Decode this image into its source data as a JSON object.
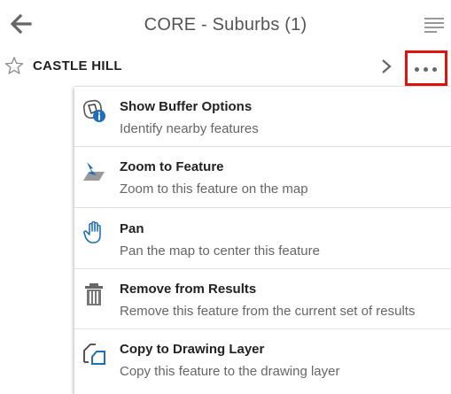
{
  "header": {
    "title": "CORE - Suburbs (1)"
  },
  "result": {
    "name": "CASTLE HILL"
  },
  "icons": {
    "back": "back-arrow-icon",
    "list": "list-icon",
    "star": "star-outline-icon",
    "chevron": "chevron-right-icon",
    "more": "more-horizontal-icon"
  },
  "colors": {
    "highlight": "#e3120b",
    "accent": "#1f6fbf"
  },
  "menu": {
    "items": [
      {
        "label": "Show Buffer Options",
        "description": "Identify nearby features",
        "icon": "buffer-info-icon"
      },
      {
        "label": "Zoom to Feature",
        "description": "Zoom to this feature on the map",
        "icon": "zoom-to-feature-icon"
      },
      {
        "label": "Pan",
        "description": "Pan the map to center this feature",
        "icon": "pan-hand-icon"
      },
      {
        "label": "Remove from Results",
        "description": "Remove this feature from the current set of results",
        "icon": "trash-icon"
      },
      {
        "label": "Copy to Drawing Layer",
        "description": "Copy this feature to the drawing layer",
        "icon": "copy-drawing-icon"
      }
    ]
  }
}
